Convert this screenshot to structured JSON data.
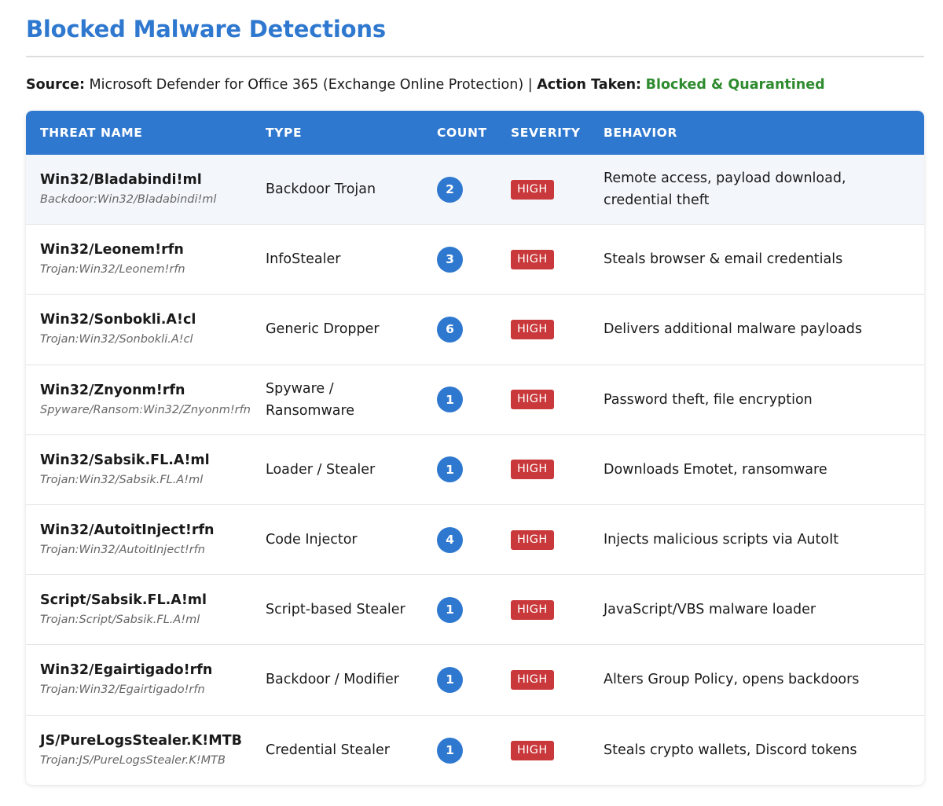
{
  "page": {
    "title": "Blocked Malware Detections",
    "source_label": "Source:",
    "source_value": "Microsoft Defender for Office 365 (Exchange Online Protection)",
    "separator": "|",
    "action_label": "Action Taken:",
    "action_value": "Blocked & Quarantined"
  },
  "table": {
    "headers": [
      "THREAT NAME",
      "TYPE",
      "COUNT",
      "SEVERITY",
      "BEHAVIOR"
    ],
    "rows": [
      {
        "name": "Win32/Bladabindi!ml",
        "id": "Backdoor:Win32/Bladabindi!ml",
        "type": "Backdoor Trojan",
        "count": "2",
        "severity": "HIGH",
        "behavior": "Remote access, payload download, credential theft"
      },
      {
        "name": "Win32/Leonem!rfn",
        "id": "Trojan:Win32/Leonem!rfn",
        "type": "InfoStealer",
        "count": "3",
        "severity": "HIGH",
        "behavior": "Steals browser & email credentials"
      },
      {
        "name": "Win32/Sonbokli.A!cl",
        "id": "Trojan:Win32/Sonbokli.A!cl",
        "type": "Generic Dropper",
        "count": "6",
        "severity": "HIGH",
        "behavior": "Delivers additional malware payloads"
      },
      {
        "name": "Win32/Znyonm!rfn",
        "id": "Spyware/Ransom:Win32/Znyonm!rfn",
        "type": "Spyware / Ransomware",
        "count": "1",
        "severity": "HIGH",
        "behavior": "Password theft, file encryption"
      },
      {
        "name": "Win32/Sabsik.FL.A!ml",
        "id": "Trojan:Win32/Sabsik.FL.A!ml",
        "type": "Loader / Stealer",
        "count": "1",
        "severity": "HIGH",
        "behavior": "Downloads Emotet, ransomware"
      },
      {
        "name": "Win32/AutoitInject!rfn",
        "id": "Trojan:Win32/AutoitInject!rfn",
        "type": "Code Injector",
        "count": "4",
        "severity": "HIGH",
        "behavior": "Injects malicious scripts via AutoIt"
      },
      {
        "name": "Script/Sabsik.FL.A!ml",
        "id": "Trojan:Script/Sabsik.FL.A!ml",
        "type": "Script-based Stealer",
        "count": "1",
        "severity": "HIGH",
        "behavior": "JavaScript/VBS malware loader"
      },
      {
        "name": "Win32/Egairtigado!rfn",
        "id": "Trojan:Win32/Egairtigado!rfn",
        "type": "Backdoor / Modifier",
        "count": "1",
        "severity": "HIGH",
        "behavior": "Alters Group Policy, opens backdoors"
      },
      {
        "name": "JS/PureLogsStealer.K!MTB",
        "id": "Trojan:JS/PureLogsStealer.K!MTB",
        "type": "Credential Stealer",
        "count": "1",
        "severity": "HIGH",
        "behavior": "Steals crypto wallets, Discord tokens"
      }
    ]
  },
  "colors": {
    "accent": "#2f78cf",
    "action_green": "#2e8b2e",
    "severity_high": "#c9383a",
    "row_highlight": "#f3f7fc"
  }
}
